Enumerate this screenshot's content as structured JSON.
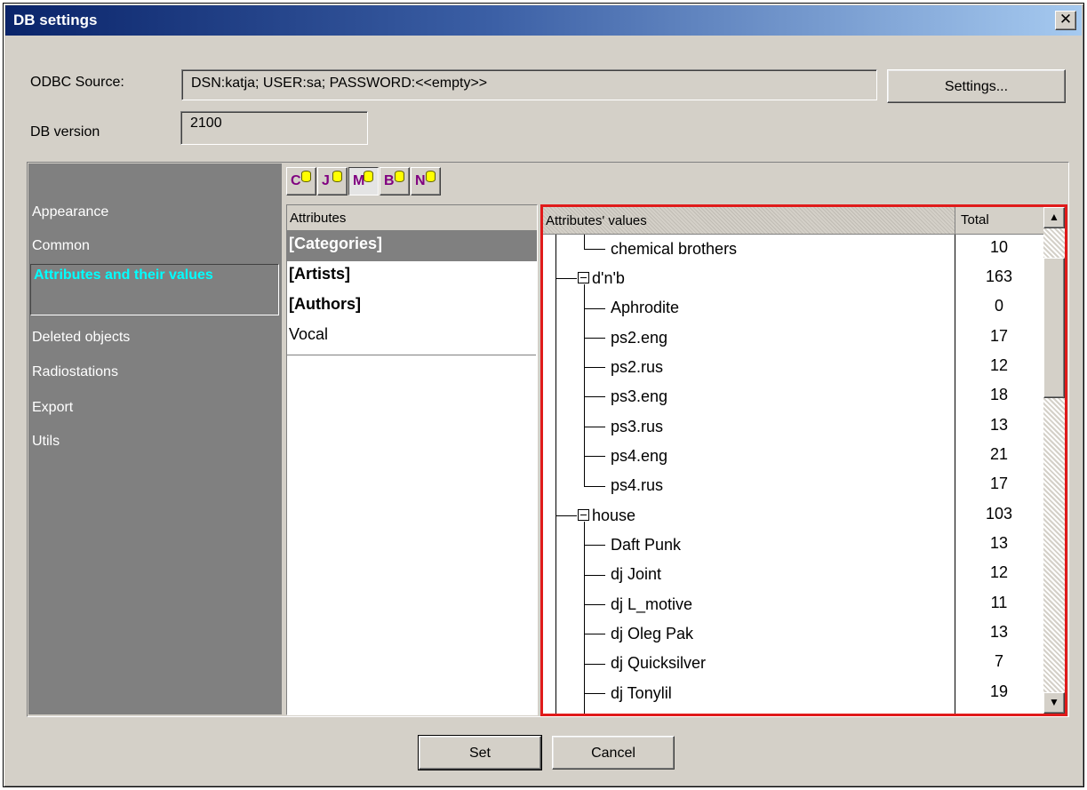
{
  "window": {
    "title": "DB settings",
    "close_glyph": "✕"
  },
  "odbc": {
    "label": "ODBC Source:",
    "value": "DSN:katja; USER:sa; PASSWORD:<<empty>>",
    "settings_button": "Settings..."
  },
  "db_version": {
    "label": "DB version",
    "value": "2100"
  },
  "nav": {
    "items": [
      {
        "label": "Appearance"
      },
      {
        "label": "Common"
      },
      {
        "label": "Attributes and their values",
        "selected": true
      },
      {
        "label": "Deleted objects"
      },
      {
        "label": "Radiostations"
      },
      {
        "label": "Export"
      },
      {
        "label": "Utils"
      }
    ]
  },
  "toolbar": {
    "buttons": [
      {
        "letter": "C",
        "icon": "database-icon"
      },
      {
        "letter": "J",
        "icon": "database-icon"
      },
      {
        "letter": "M",
        "icon": "database-icon",
        "active": true
      },
      {
        "letter": "B",
        "icon": "database-icon"
      },
      {
        "letter": "N",
        "icon": "database-icon"
      }
    ]
  },
  "attributes": {
    "header": "Attributes",
    "items": [
      {
        "label": "[Categories]",
        "bold": true,
        "selected": true
      },
      {
        "label": "[Artists]",
        "bold": true
      },
      {
        "label": "[Authors]",
        "bold": true
      },
      {
        "label": "Vocal"
      }
    ]
  },
  "values": {
    "header_name": "Attributes' values",
    "header_total": "Total",
    "rows": [
      {
        "label": "chemical brothers",
        "total": "10"
      },
      {
        "label": "d'n'b",
        "total": "163"
      },
      {
        "label": "Aphrodite",
        "total": "0"
      },
      {
        "label": "ps2.eng",
        "total": "17"
      },
      {
        "label": "ps2.rus",
        "total": "12"
      },
      {
        "label": "ps3.eng",
        "total": "18"
      },
      {
        "label": "ps3.rus",
        "total": "13"
      },
      {
        "label": "ps4.eng",
        "total": "21"
      },
      {
        "label": "ps4.rus",
        "total": "17"
      },
      {
        "label": "house",
        "total": "103"
      },
      {
        "label": "Daft Punk",
        "total": "13"
      },
      {
        "label": "dj Joint",
        "total": "12"
      },
      {
        "label": "dj L_motive",
        "total": "11"
      },
      {
        "label": "dj Oleg Pak",
        "total": "13"
      },
      {
        "label": "dj Quicksilver",
        "total": "7"
      },
      {
        "label": "dj Tonylil",
        "total": "19"
      }
    ]
  },
  "scrollbar": {
    "up_glyph": "▲",
    "down_glyph": "▼"
  },
  "footer": {
    "set_button": "Set",
    "cancel_button": "Cancel"
  }
}
